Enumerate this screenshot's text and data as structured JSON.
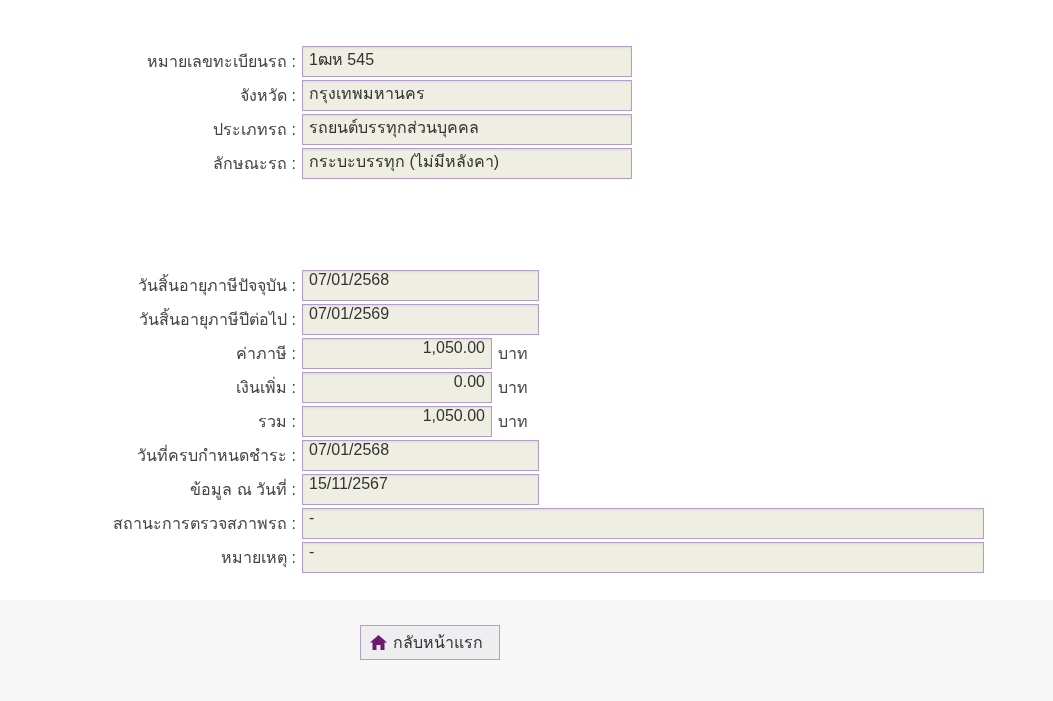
{
  "sections": [
    {
      "fields": [
        {
          "label": "หมายเลขทะเบียนรถ :",
          "value": "1ฒห 545",
          "kind": "wide"
        },
        {
          "label": "จังหวัด :",
          "value": "กรุงเทพมหานคร",
          "kind": "wide"
        },
        {
          "label": "ประเภทรถ :",
          "value": "รถยนต์บรรทุกส่วนบุคคล",
          "kind": "wide"
        },
        {
          "label": "ลักษณะรถ :",
          "value": "กระบะบรรทุก (ไม่มีหลังคา)",
          "kind": "wide"
        }
      ]
    },
    {
      "fields": [
        {
          "label": "วันสิ้นอายุภาษีปัจจุบัน :",
          "value": "07/01/2568",
          "kind": "date"
        },
        {
          "label": "วันสิ้นอายุภาษีปีต่อไป :",
          "value": "07/01/2569",
          "kind": "date"
        },
        {
          "label": "ค่าภาษี :",
          "value": "1,050.00",
          "kind": "money",
          "unit": "บาท"
        },
        {
          "label": "เงินเพิ่ม :",
          "value": "0.00",
          "kind": "money",
          "unit": "บาท"
        },
        {
          "label": "รวม :",
          "value": "1,050.00",
          "kind": "money",
          "unit": "บาท"
        },
        {
          "label": "วันที่ครบกำหนดชำระ :",
          "value": "07/01/2568",
          "kind": "date"
        },
        {
          "label": "ข้อมูล ณ วันที่ :",
          "value": "15/11/2567",
          "kind": "date"
        },
        {
          "label": "สถานะการตรวจสภาพรถ :",
          "value": "-",
          "kind": "full"
        },
        {
          "label": "หมายเหตุ :",
          "value": "-",
          "kind": "full"
        }
      ]
    }
  ],
  "footer": {
    "home_button": "กลับหน้าแรก"
  }
}
